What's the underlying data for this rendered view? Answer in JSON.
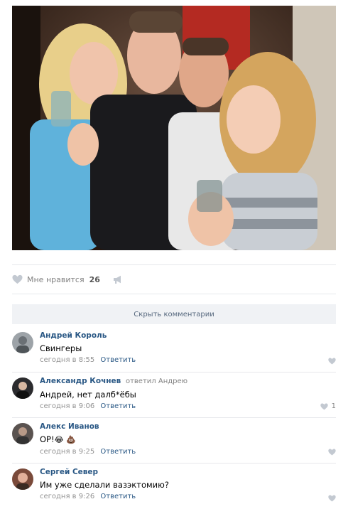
{
  "post": {
    "likes_label": "Мне нравится",
    "likes_count": "26"
  },
  "hide_comments_label": "Скрыть комментарии",
  "comments": [
    {
      "author": "Андрей Король",
      "reply_to": "",
      "text": "Свингеры",
      "time": "сегодня в 8:55",
      "reply_label": "Ответить",
      "likes": ""
    },
    {
      "author": "Александр Кочнев",
      "reply_to": "ответил Андрею",
      "text": "Андрей, нет далб*ёбы",
      "time": "сегодня в 9:06",
      "reply_label": "Ответить",
      "likes": "1"
    },
    {
      "author": "Алекс Иванов",
      "reply_to": "",
      "text": "ОР!",
      "emoji": "😂 💩",
      "time": "сегодня в 9:25",
      "reply_label": "Ответить",
      "likes": ""
    },
    {
      "author": "Сергей Север",
      "reply_to": "",
      "text": "Им уже сделали вазэктомию?",
      "time": "сегодня в 9:26",
      "reply_label": "Ответить",
      "likes": ""
    }
  ],
  "colors": {
    "link": "#2a5885",
    "meta": "#939393",
    "divider": "#e7e8ec",
    "hide_bar_bg": "#f0f2f5"
  },
  "icons": [
    "heart-icon",
    "megaphone-icon",
    "avatar"
  ]
}
